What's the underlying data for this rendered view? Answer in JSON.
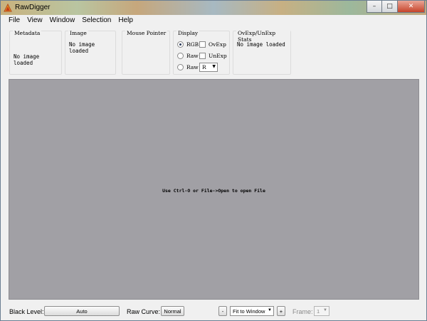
{
  "titlebar": {
    "title": "RawDigger",
    "minimize": "–",
    "maximize": "□",
    "close": "✕"
  },
  "menu": [
    "File",
    "View",
    "Window",
    "Selection",
    "Help"
  ],
  "panels": {
    "metadata": {
      "title": "Metadata",
      "text": "No image loaded"
    },
    "image": {
      "title": "Image",
      "text": "No image loaded"
    },
    "mouse": {
      "title": "Mouse Pointer"
    },
    "display": {
      "title": "Display",
      "radio_rgb": "RGB",
      "radio_raw1": "Raw",
      "radio_raw2": "Raw",
      "check_ovexp": "OvExp",
      "check_unexp": "UnExp",
      "channel": "R"
    },
    "stats": {
      "title": "OvExp/UnExp Stats",
      "text": "No image loaded"
    }
  },
  "image_area": {
    "hint": "Use Ctrl-O or File->Open to open File"
  },
  "bottom": {
    "black_level_label": "Black Level:",
    "black_level_value": "Auto",
    "raw_curve_label": "Raw Curve:",
    "raw_curve_value": "Normal",
    "zoom_out": "-",
    "zoom_value": "Fit to Window",
    "zoom_in": "+",
    "frame_label": "Frame:",
    "frame_value": "1"
  }
}
